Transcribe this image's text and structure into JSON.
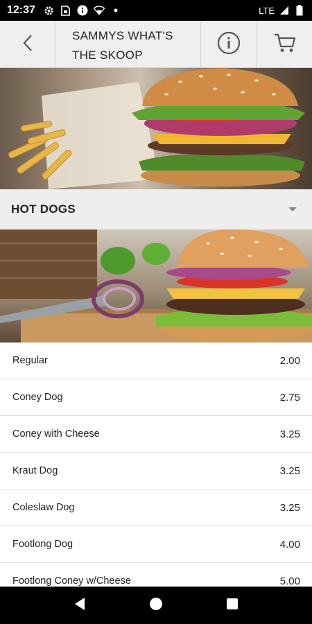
{
  "status_bar": {
    "time": "12:37",
    "network": "LTE",
    "icons_left": [
      "gear-icon",
      "sim-icon",
      "info-icon",
      "wifi-icon",
      "dot-icon"
    ],
    "icons_right": [
      "signal-icon",
      "battery-icon"
    ]
  },
  "header": {
    "title": "SAMMYS WHAT'S THE SKOOP",
    "back_icon": "chevron-left-icon",
    "info_icon": "info-icon",
    "cart_icon": "cart-icon"
  },
  "images": {
    "top": "burger-and-fries-photo",
    "section": "burger-on-board-photo"
  },
  "section": {
    "title": "HOT DOGS",
    "expand_icon": "caret-down-icon"
  },
  "menu": {
    "items": [
      {
        "name": "Regular",
        "price": "2.00"
      },
      {
        "name": "Coney Dog",
        "price": "2.75"
      },
      {
        "name": "Coney with Cheese",
        "price": "3.25"
      },
      {
        "name": "Kraut Dog",
        "price": "3.25"
      },
      {
        "name": "Coleslaw Dog",
        "price": "3.25"
      },
      {
        "name": "Footlong Dog",
        "price": "4.00"
      },
      {
        "name": "Footlong Coney w/Cheese",
        "price": "5.00"
      }
    ]
  },
  "nav": {
    "back": "back-triangle-icon",
    "home": "home-circle-icon",
    "recents": "recents-square-icon"
  },
  "colors": {
    "header_bg": "#eeeeee",
    "section_bg": "#eeeeee",
    "divider": "#dedede",
    "text": "#222222"
  }
}
